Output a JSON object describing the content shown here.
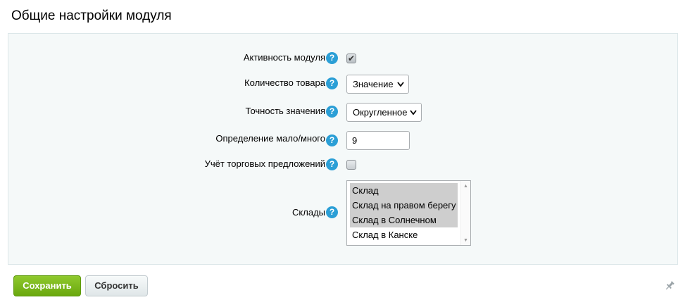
{
  "page": {
    "title": "Общие настройки модуля"
  },
  "form": {
    "module_active": {
      "label": "Активность модуля",
      "checked": true
    },
    "product_quantity": {
      "label": "Количество товара",
      "value": "Значение"
    },
    "value_precision": {
      "label": "Точность значения",
      "value": "Округленное"
    },
    "few_many": {
      "label": "Определение мало/много",
      "value": "9"
    },
    "trade_offers": {
      "label": "Учёт торговых предложений",
      "checked": false
    },
    "warehouses": {
      "label": "Склады",
      "options": [
        {
          "label": "Склад",
          "selected": true
        },
        {
          "label": "Склад на правом берегу",
          "selected": true
        },
        {
          "label": "Склад в Солнечном",
          "selected": true
        },
        {
          "label": "Склад в Канске",
          "selected": false
        }
      ]
    },
    "help_glyph": "?"
  },
  "actions": {
    "save_label": "Сохранить",
    "reset_label": "Сбросить"
  },
  "icons": {
    "help": "help-icon",
    "pin": "pin-icon",
    "dropdown": "chevron-down-icon"
  },
  "colors": {
    "help_bg": "#2b9fd6",
    "save_bg": "#7cb91d",
    "panel_bg": "#f5f9f9",
    "selected_option_bg": "#cecece"
  }
}
